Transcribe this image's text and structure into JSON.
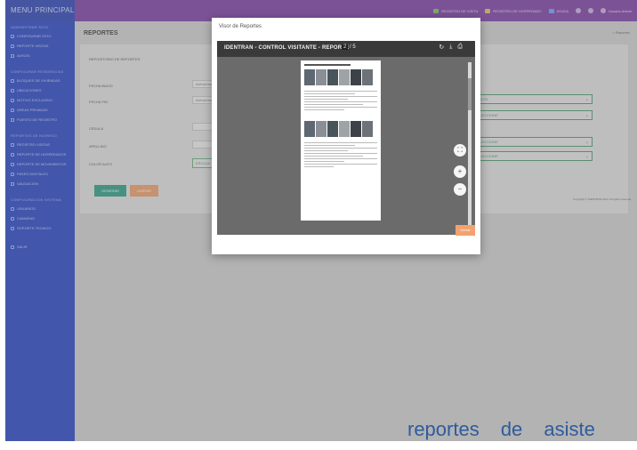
{
  "app": {
    "menu_title": "MENU PRINCIPAL"
  },
  "topnav": [
    {
      "label": "REGISTRO DE VISITA",
      "icon": "qr-icon"
    },
    {
      "label": "REGISTRO DE HOSPEDADO",
      "icon": "id-card-icon"
    },
    {
      "label": "AYUDA",
      "icon": "help-icon"
    },
    {
      "label": "Usuario Admin",
      "icon": "avatar"
    }
  ],
  "sidebar": {
    "sections": [
      {
        "heading": "ADMINISTRAR SITIO",
        "items": [
          "CONFIGURAR SITIO",
          "REPORTE VISITAS",
          "AVISOS"
        ]
      },
      {
        "heading": "CONFIGURAR RESIDENCIAS",
        "items": [
          "BLOQUES DE VIVIENDAS",
          "UBICACIONES",
          "MOTIVO EXCLUSIVO",
          "AREAS PRIVADAS",
          "PUESTO DE REGISTRO"
        ]
      },
      {
        "heading": "REPORTES DE INGRESO",
        "items": [
          "REGISTRO VISITAS",
          "REPORTE DE HOSPEDADOS",
          "REPORTE DE MOVIMIENTOS",
          "PASES DIGITALES",
          "VALIDACION"
        ]
      },
      {
        "heading": "CONFIGURACION SISTEMA",
        "items": [
          "USUARIOS",
          "CAMARAS",
          "SOPORTE TECNICO"
        ]
      },
      {
        "heading": "",
        "items": [
          "SALIR"
        ]
      }
    ]
  },
  "main": {
    "title": "REPORTES",
    "breadcrumb": "Reportes",
    "card_heading": "REPOSITORIO DE REPORTES",
    "fields": [
      {
        "label": "FECHA INICIO",
        "value": "dd/mm/aaaa"
      },
      {
        "label": "FECHA FIN",
        "value": "dd/mm/aaaa"
      },
      {
        "label": "CEDULA",
        "value": ""
      },
      {
        "label": "APELLIDO",
        "value": ""
      },
      {
        "label": "COLOR AUTO",
        "value": ""
      }
    ],
    "right_selects": [
      "TODOS",
      "SELECCIONE",
      "SELECCIONE",
      "SELECCIONE"
    ],
    "color_button": "ESCOJA",
    "generate_button": "GENERAR",
    "clear_button": "LIMPIAR",
    "copyright": "Copyright © IDENTRAN 2024. All rights reserved."
  },
  "modal": {
    "title": "Visor de Reportes",
    "viewer_title": "IDENTRAN - CONTROL VISITANTE - REPORTE",
    "page_current": "2",
    "page_total": "5",
    "close_button": "Cerrar"
  },
  "caption": "reportes de asiste"
}
